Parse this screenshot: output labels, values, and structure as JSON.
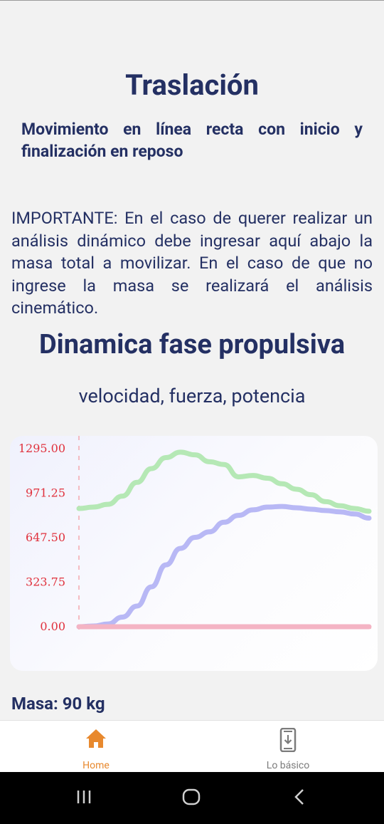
{
  "header": {
    "title": "Traslación",
    "subtitle": "Movimiento en línea recta con inicio y finalización en reposo"
  },
  "notice": "IMPORTANTE: En el caso de querer realizar un análisis dinámico debe ingresar aquí abajo la masa total a movilizar. En el caso de que no ingrese la masa se realizará el análisis cinemático.",
  "section": {
    "title": "Dinamica fase propulsiva",
    "chart_subtitle": "velocidad, fuerza, potencia"
  },
  "mass_label": "Masa: 90 kg",
  "nav": {
    "items": [
      {
        "label": "Home",
        "icon": "home-icon",
        "active": true
      },
      {
        "label": "Lo básico",
        "icon": "phone-download-icon",
        "active": false
      }
    ]
  },
  "system_nav": {
    "icons": [
      "recent-apps-icon",
      "home-circle-icon",
      "back-icon"
    ]
  },
  "colors": {
    "text": "#243063",
    "accent": "#e8892e",
    "axis_label": "#e0303c",
    "series_green": "#b5e8b5",
    "series_blue": "#b8b8f5",
    "series_pink": "#f4b4c4"
  },
  "chart_data": {
    "type": "line",
    "ylim": [
      0,
      1295
    ],
    "yticks": [
      "1295.00",
      "971.25",
      "647.50",
      "323.75",
      "0.00"
    ],
    "x": [
      0,
      1,
      2,
      3,
      4,
      5,
      6,
      7,
      8,
      9,
      10,
      11,
      12,
      13,
      14,
      15,
      16,
      17,
      18,
      19,
      20
    ],
    "series": [
      {
        "color": "#b5e8b5",
        "values": [
          860,
          870,
          890,
          950,
          1050,
          1150,
          1230,
          1270,
          1250,
          1200,
          1180,
          1090,
          1100,
          1080,
          1040,
          1000,
          960,
          910,
          880,
          860,
          840
        ]
      },
      {
        "color": "#b8b8f5",
        "values": [
          0,
          5,
          20,
          70,
          150,
          290,
          450,
          570,
          650,
          690,
          760,
          810,
          850,
          870,
          875,
          865,
          855,
          845,
          835,
          820,
          790
        ]
      },
      {
        "color": "#f4b4c4",
        "values": [
          0,
          0,
          0,
          0,
          0,
          0,
          0,
          0,
          0,
          0,
          0,
          0,
          0,
          0,
          0,
          0,
          0,
          0,
          0,
          0,
          0
        ]
      }
    ]
  }
}
